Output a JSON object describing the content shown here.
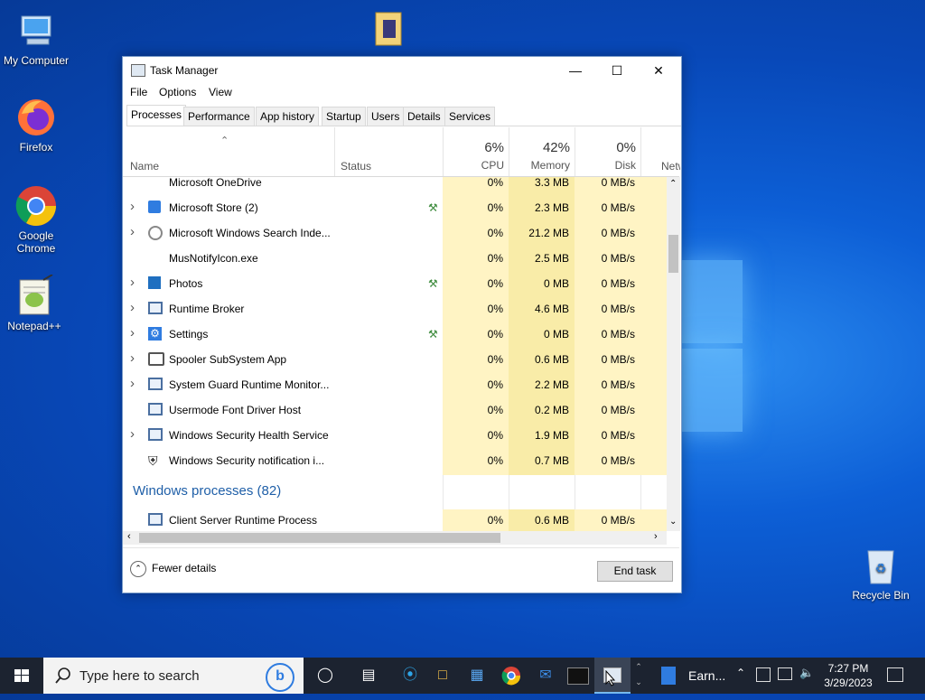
{
  "desktop": {
    "icons": [
      {
        "label": "My Computer"
      },
      {
        "label": "Firefox"
      },
      {
        "label": "Google Chrome"
      },
      {
        "label": "Notepad++"
      },
      {
        "label": "Recycle Bin"
      }
    ]
  },
  "taskmanager": {
    "title": "Task Manager",
    "menu": [
      "File",
      "Options",
      "View"
    ],
    "tabs": [
      "Processes",
      "Performance",
      "App history",
      "Startup",
      "Users",
      "Details",
      "Services"
    ],
    "active_tab": "Processes",
    "columns": {
      "name": "Name",
      "status": "Status",
      "cpu": {
        "pct": "6%",
        "label": "CPU"
      },
      "memory": {
        "pct": "42%",
        "label": "Memory"
      },
      "disk": {
        "pct": "0%",
        "label": "Disk"
      },
      "network": {
        "label": "Netw"
      }
    },
    "rows": [
      {
        "name": "Microsoft OneDrive",
        "cpu": "0%",
        "memory": "3.3 MB",
        "disk": "0 MB/s",
        "expandable": false,
        "leaf": false,
        "icon": "cloud-icon"
      },
      {
        "name": "Microsoft Store (2)",
        "cpu": "0%",
        "memory": "2.3 MB",
        "disk": "0 MB/s",
        "expandable": true,
        "leaf": true,
        "icon": "store-icon"
      },
      {
        "name": "Microsoft Windows Search Inde...",
        "cpu": "0%",
        "memory": "21.2 MB",
        "disk": "0 MB/s",
        "expandable": true,
        "leaf": false,
        "icon": "search-user-icon"
      },
      {
        "name": "MusNotifyIcon.exe",
        "cpu": "0%",
        "memory": "2.5 MB",
        "disk": "0 MB/s",
        "expandable": false,
        "leaf": false,
        "icon": "none"
      },
      {
        "name": "Photos",
        "cpu": "0%",
        "memory": "0 MB",
        "disk": "0 MB/s",
        "expandable": true,
        "leaf": true,
        "icon": "photos-icon"
      },
      {
        "name": "Runtime Broker",
        "cpu": "0%",
        "memory": "4.6 MB",
        "disk": "0 MB/s",
        "expandable": true,
        "leaf": false,
        "icon": "window-icon"
      },
      {
        "name": "Settings",
        "cpu": "0%",
        "memory": "0 MB",
        "disk": "0 MB/s",
        "expandable": true,
        "leaf": true,
        "icon": "gear-icon"
      },
      {
        "name": "Spooler SubSystem App",
        "cpu": "0%",
        "memory": "0.6 MB",
        "disk": "0 MB/s",
        "expandable": true,
        "leaf": false,
        "icon": "printer-icon"
      },
      {
        "name": "System Guard Runtime Monitor...",
        "cpu": "0%",
        "memory": "2.2 MB",
        "disk": "0 MB/s",
        "expandable": true,
        "leaf": false,
        "icon": "window-icon"
      },
      {
        "name": "Usermode Font Driver Host",
        "cpu": "0%",
        "memory": "0.2 MB",
        "disk": "0 MB/s",
        "expandable": false,
        "leaf": false,
        "icon": "window-icon"
      },
      {
        "name": "Windows Security Health Service",
        "cpu": "0%",
        "memory": "1.9 MB",
        "disk": "0 MB/s",
        "expandable": true,
        "leaf": false,
        "icon": "window-icon"
      },
      {
        "name": "Windows Security notification i...",
        "cpu": "0%",
        "memory": "0.7 MB",
        "disk": "0 MB/s",
        "expandable": false,
        "leaf": false,
        "icon": "shield-icon"
      }
    ],
    "group": "Windows processes (82)",
    "group_rows": [
      {
        "name": "Client Server Runtime Process",
        "cpu": "0%",
        "memory": "0.6 MB",
        "disk": "0 MB/s",
        "icon": "window-icon"
      }
    ],
    "fewer_details": "Fewer details",
    "end_task": "End task"
  },
  "taskbar": {
    "search_placeholder": "Type here to search",
    "pinned_app_label": "Earn...",
    "clock_time": "7:27 PM",
    "clock_date": "3/29/2023"
  },
  "colors": {
    "accent": "#0078d7",
    "heat": "#fff4c4",
    "heat_strong": "#f9eca8",
    "taskbar": "#1c2330"
  }
}
